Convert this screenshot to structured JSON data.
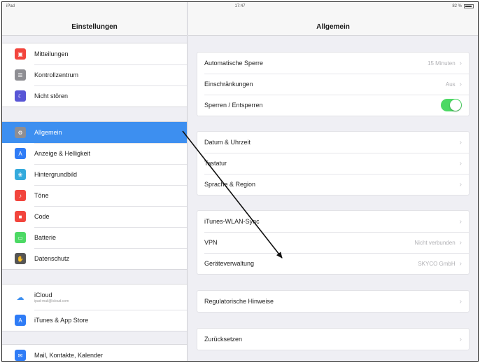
{
  "status_bar": {
    "carrier": "iPad",
    "time": "17:47",
    "battery": "82 %"
  },
  "sidebar": {
    "title": "Einstellungen",
    "groups": [
      [
        {
          "label": "Mitteilungen",
          "icon": "notifications-icon",
          "color": "#f2453d"
        },
        {
          "label": "Kontrollzentrum",
          "icon": "control-center-icon",
          "color": "#8e8e93"
        },
        {
          "label": "Nicht stören",
          "icon": "moon-icon",
          "color": "#5856d6"
        }
      ],
      [
        {
          "label": "Allgemein",
          "icon": "gear-icon",
          "color": "#8e8e93",
          "selected": true
        },
        {
          "label": "Anzeige & Helligkeit",
          "icon": "display-icon",
          "color": "#2f7cf6"
        },
        {
          "label": "Hintergrundbild",
          "icon": "wallpaper-icon",
          "color": "#34aadc"
        },
        {
          "label": "Töne",
          "icon": "speaker-icon",
          "color": "#f2453d"
        },
        {
          "label": "Code",
          "icon": "lock-icon",
          "color": "#f2453d"
        },
        {
          "label": "Batterie",
          "icon": "battery-icon",
          "color": "#4cd964"
        },
        {
          "label": "Datenschutz",
          "icon": "hand-icon",
          "color": "#555555"
        }
      ],
      [
        {
          "label": "iCloud",
          "sub": "ipad-mail@icloud.com",
          "icon": "cloud-icon",
          "color": "#ffffff"
        },
        {
          "label": "iTunes & App Store",
          "icon": "app-store-icon",
          "color": "#2f7cf6"
        }
      ],
      [
        {
          "label": "Mail, Kontakte, Kalender",
          "icon": "mail-icon",
          "color": "#2f7cf6"
        }
      ]
    ]
  },
  "main": {
    "title": "Allgemein",
    "sections": [
      [
        {
          "label": "Automatische Sperre",
          "value": "15 Minuten"
        },
        {
          "label": "Einschränkungen",
          "value": "Aus"
        },
        {
          "label": "Sperren / Entsperren",
          "toggle": true
        }
      ],
      [
        {
          "label": "Datum & Uhrzeit"
        },
        {
          "label": "Tastatur"
        },
        {
          "label": "Sprache & Region"
        }
      ],
      [
        {
          "label": "iTunes-WLAN-Sync"
        },
        {
          "label": "VPN",
          "value": "Nicht verbunden"
        },
        {
          "label": "Geräteverwaltung",
          "value": "SKYCO GmbH"
        }
      ],
      [
        {
          "label": "Regulatorische Hinweise"
        }
      ],
      [
        {
          "label": "Zurücksetzen"
        }
      ]
    ]
  },
  "colors": {
    "accent": "#3d8ff0",
    "toggle_on": "#4cd964",
    "background": "#efeff4"
  }
}
